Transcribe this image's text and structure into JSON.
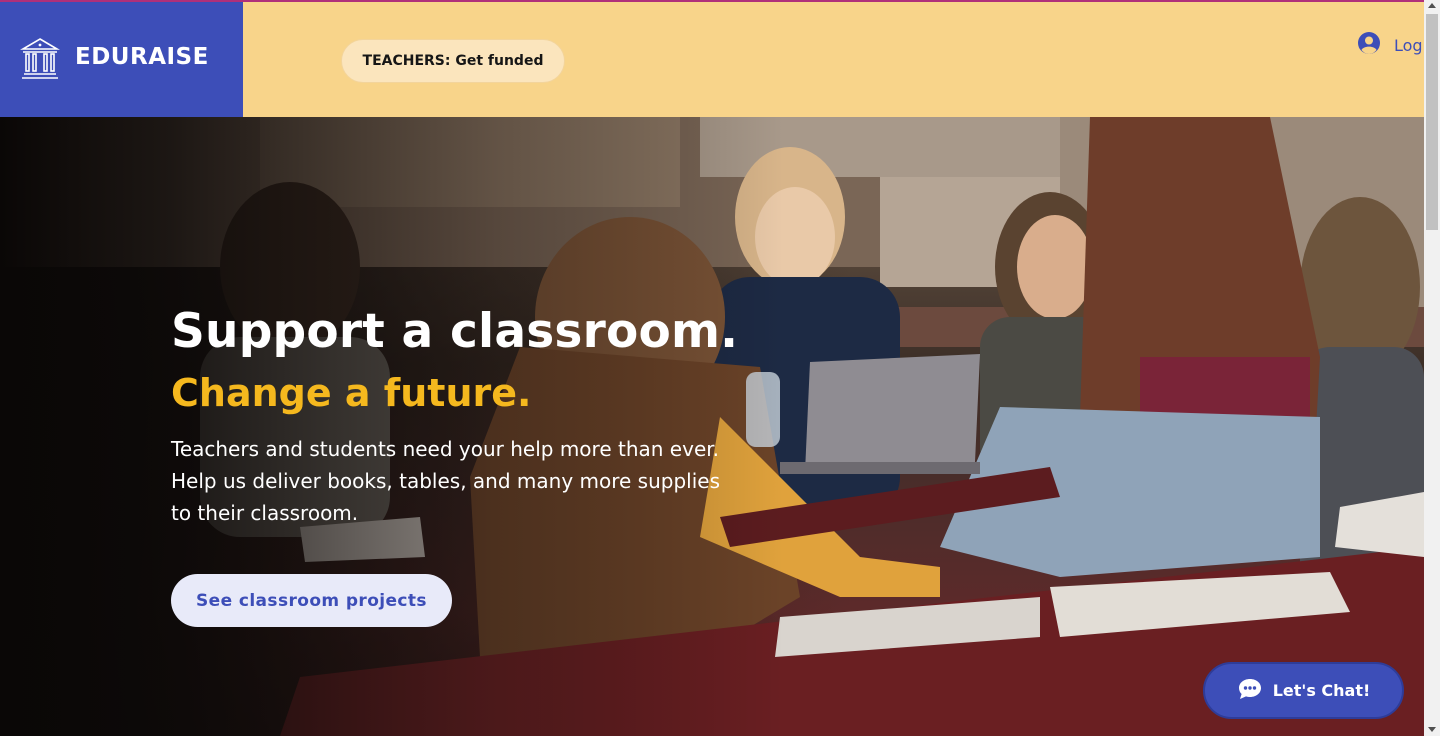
{
  "brand": {
    "name": "EDURAISE",
    "icon": "classical-building-icon",
    "logo_bg": "#3d4eb8"
  },
  "header": {
    "bg": "#f8d48a",
    "teachers_pill": "TEACHERS: Get funded",
    "login_label": "Log",
    "login_icon": "user-avatar-icon"
  },
  "hero": {
    "title": "Support a classroom.",
    "subtitle": "Change a future.",
    "body": "Teachers and students need your help more than ever. Help us deliver books, tables, and many more supplies to their classroom.",
    "cta": "See classroom projects",
    "subtitle_color": "#f5b81e",
    "image": "students-in-classroom-photo"
  },
  "chat": {
    "label": "Let's Chat!",
    "icon": "chat-bubble-icon"
  }
}
